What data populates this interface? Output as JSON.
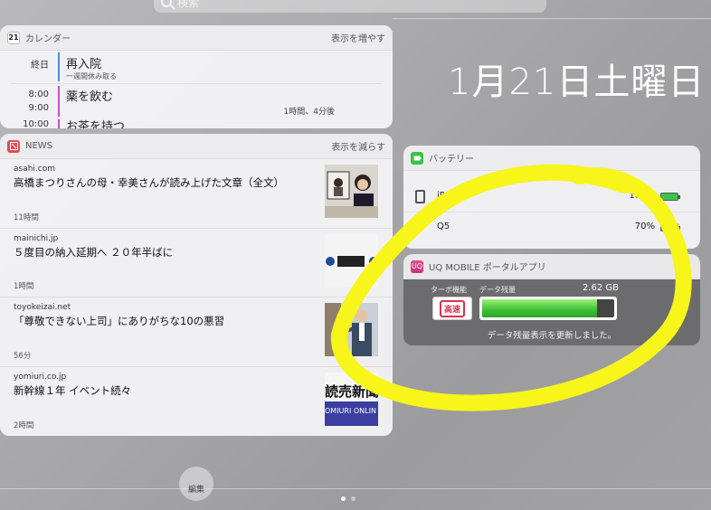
{
  "search": {
    "placeholder": "検索"
  },
  "date": "1月21日土曜日",
  "calendar": {
    "app_title": "カレンダー",
    "icon_day": "21",
    "action": "表示を増やす",
    "events": [
      {
        "time_start": "終日",
        "time_end": "",
        "title": "再入院",
        "subtitle": "一週間休み取る",
        "duration": "",
        "color": "#4a90d9"
      },
      {
        "time_start": "8:00",
        "time_end": "9:00",
        "title": "薬を飲む",
        "subtitle": "",
        "duration": "1時間、4分後",
        "color": "#c64fc9"
      },
      {
        "time_start": "10:00",
        "time_end": "",
        "title": "お茶を持つ",
        "subtitle": "",
        "duration": "",
        "color": "#c64fc9"
      }
    ]
  },
  "news": {
    "app_title": "NEWS",
    "action": "表示を減らす",
    "items": [
      {
        "source": "asahi.com",
        "headline": "高橋まつりさんの母・幸美さんが読み上げた文章（全文）",
        "time": "11時間"
      },
      {
        "source": "mainichi.jp",
        "headline": "５度目の納入延期へ ２０年半ばに",
        "time": "1時間"
      },
      {
        "source": "toyokeizai.net",
        "headline": "「尊敬できない上司」にありがちな10の悪習",
        "time": "56分"
      },
      {
        "source": "yomiuri.co.jp",
        "headline": "新幹線１年 イベント続々",
        "time": "2時間"
      }
    ],
    "thumb4_text_top": "読売新聞",
    "thumb4_text_bottom": "OMIURI ONLIN"
  },
  "battery": {
    "app_title": "バッテリー",
    "devices": [
      {
        "name": "iPad",
        "percent": "100%",
        "level": 1.0
      },
      {
        "name": "Q5",
        "percent": "70%",
        "level": 0.7
      }
    ]
  },
  "uq": {
    "app_title": "UQ MOBILE ポータルアプリ",
    "turbo_label": "ターボ機能",
    "turbo_button": "高速",
    "data_label": "データ残量",
    "data_value": "2.62 GB",
    "data_level": 0.87,
    "status": "データ残量表示を更新しました。"
  },
  "edit_label": "編集",
  "colors": {
    "annotation": "#f7f51a",
    "battery_green": "#3ac44b",
    "news_red": "#e84a55"
  }
}
